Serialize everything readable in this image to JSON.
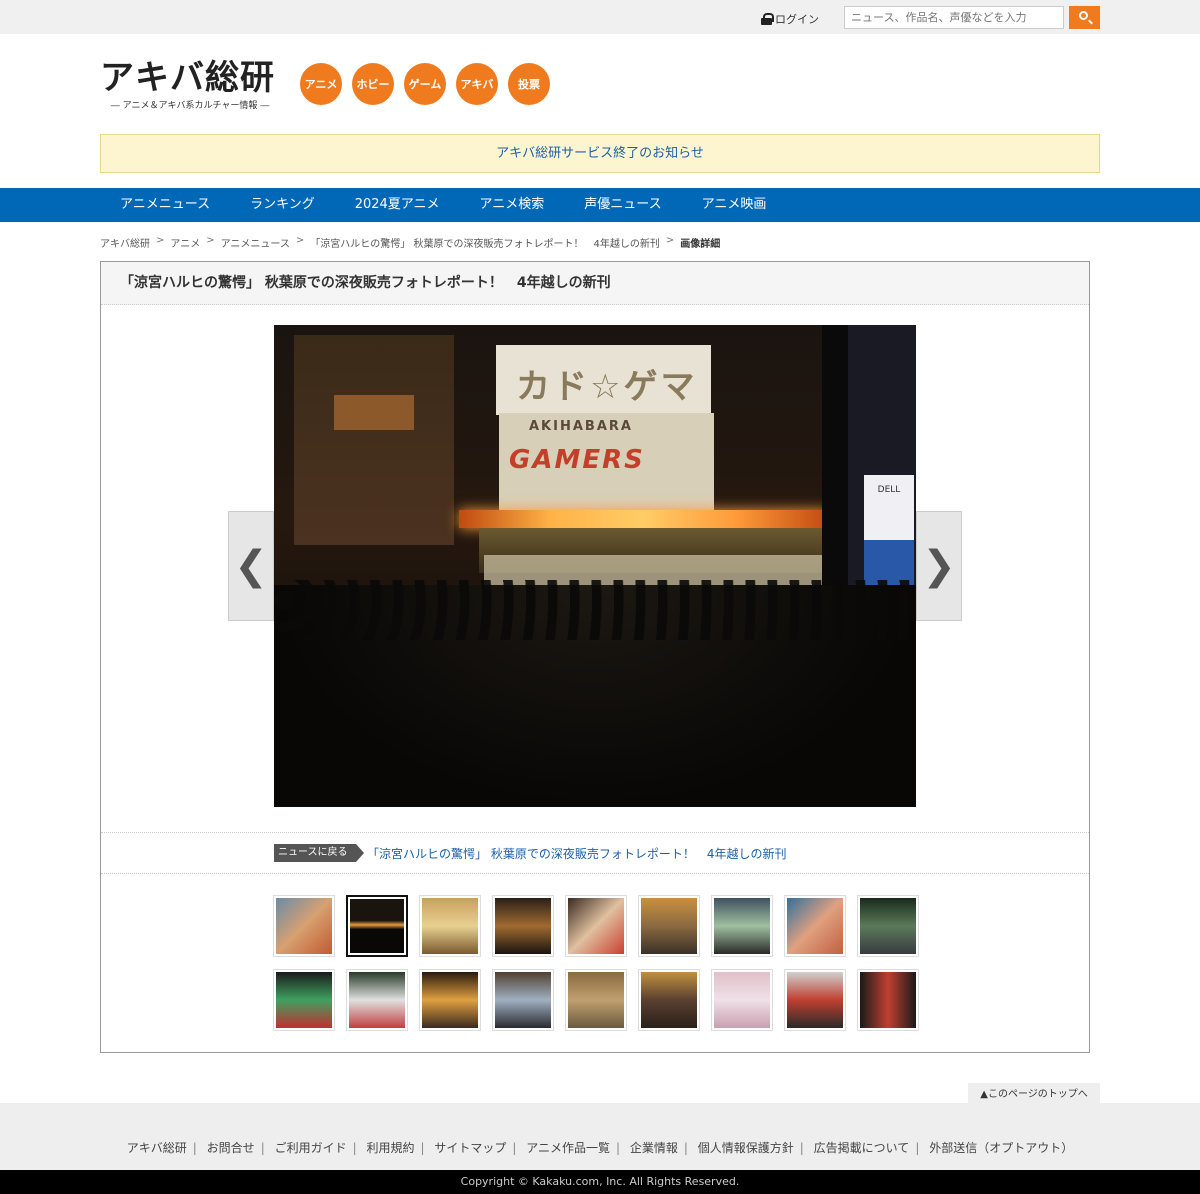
{
  "topbar": {
    "login_label": "ログイン",
    "search_placeholder": "ニュース、作品名、声優などを入力"
  },
  "header": {
    "logo_title": "アキバ総研",
    "logo_subtitle": "― アニメ＆アキバ系カルチャー情報 ―",
    "categories": [
      "アニメ",
      "ホビー",
      "ゲーム",
      "アキバ",
      "投票"
    ]
  },
  "notice": {
    "text": "アキバ総研サービス終了のお知らせ"
  },
  "main_nav": [
    "アニメニュース",
    "ランキング",
    "2024夏アニメ",
    "アニメ検索",
    "声優ニュース",
    "アニメ映画"
  ],
  "breadcrumb": {
    "items": [
      "アキバ総研",
      "アニメ",
      "アニメニュース",
      "「涼宮ハルヒの驚愕」 秋葉原での深夜販売フォトレポート！　4年越しの新刊"
    ],
    "current": "画像詳細"
  },
  "article": {
    "title": "「涼宮ハルヒの驚愕」 秋葉原での深夜販売フォトレポート！　4年越しの新刊",
    "photo_signs": {
      "top": "カド☆ゲマ",
      "akihabara": "AKIHABARA",
      "gamers": "GAMERS",
      "dell": "DELL"
    },
    "prev_arrow": "❮",
    "next_arrow": "❯",
    "back_label": "ニュースに戻る",
    "back_link": "「涼宮ハルヒの驚愕」 秋葉原での深夜販売フォトレポート！　4年越しの新刊",
    "thumbnails_count": 18,
    "selected_thumbnail_index": 1
  },
  "footer": {
    "pagetop": "▲このページのトップへ",
    "links": [
      "アキバ総研",
      "お問合せ",
      "ご利用ガイド",
      "利用規約",
      "サイトマップ",
      "アニメ作品一覧",
      "企業情報",
      "個人情報保護方針",
      "広告掲載について",
      "外部送信（オプトアウト）"
    ],
    "copyright": "Copyright © Kakaku.com, Inc. All Rights Reserved."
  },
  "colors": {
    "accent": "#f07b1f",
    "nav_blue": "#0068b7",
    "link": "#1c5fa8",
    "notice_bg": "#fdf5d0"
  }
}
